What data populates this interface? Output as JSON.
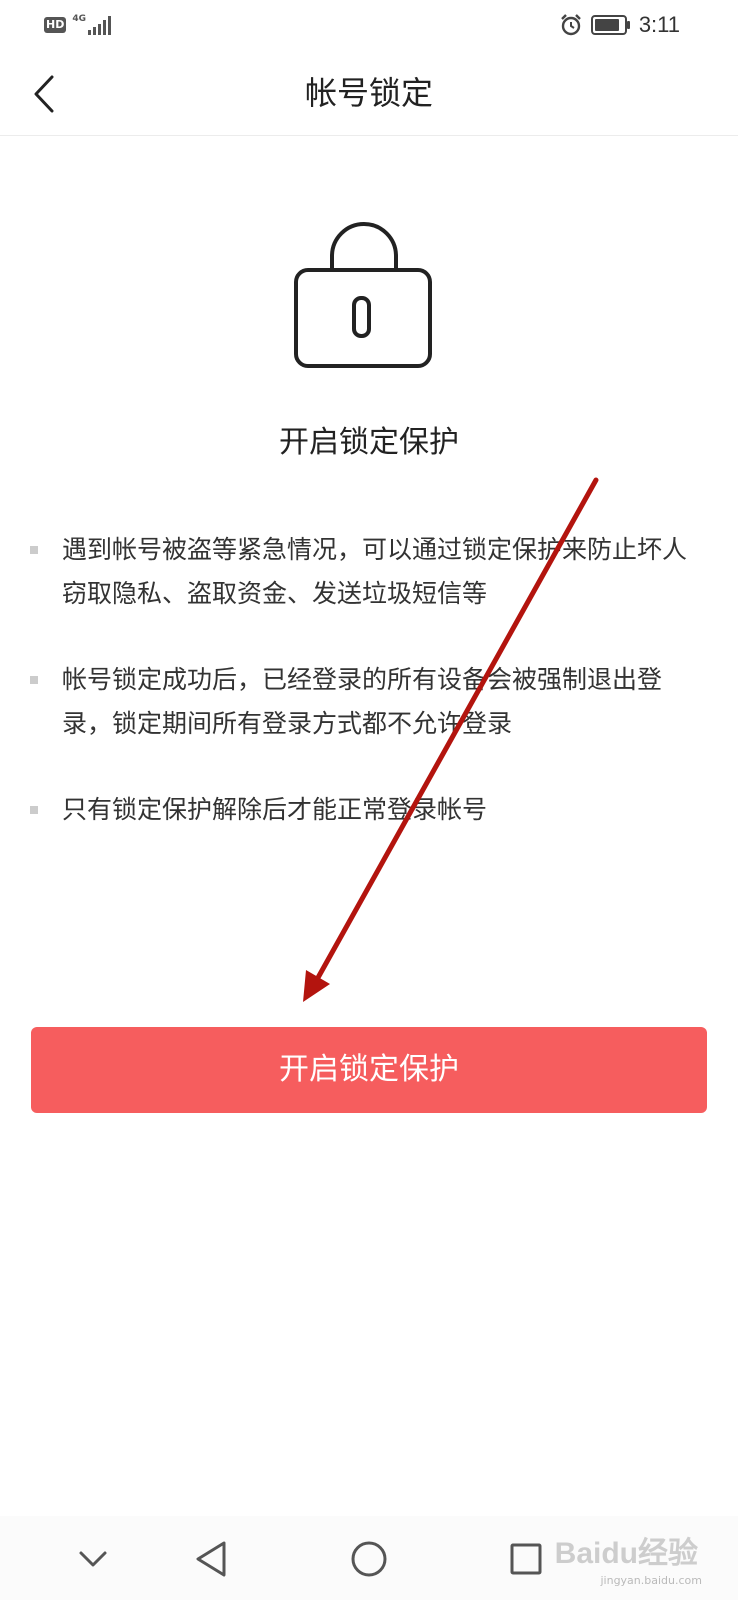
{
  "status_bar": {
    "hd_label": "HD",
    "network_label": "4G",
    "time": "3:11",
    "icons": [
      "hd-badge",
      "signal-icon",
      "alarm-icon",
      "battery-icon"
    ]
  },
  "nav": {
    "title": "帐号锁定",
    "back_icon": "chevron-left-icon"
  },
  "content": {
    "lock_icon": "lock-icon",
    "headline": "开启锁定保护",
    "bullets": [
      "遇到帐号被盗等紧急情况，可以通过锁定保护来防止坏人窃取隐私、盗取资金、发送垃圾短信等",
      "帐号锁定成功后，已经登录的所有设备会被强制退出登录，锁定期间所有登录方式都不允许登录",
      "只有锁定保护解除后才能正常登录帐号"
    ]
  },
  "button": {
    "label": "开启锁定保护",
    "color": "#f65d5e"
  },
  "annotation": {
    "type": "arrow",
    "color": "#b3140e"
  },
  "system_nav": {
    "icons": [
      "collapse-chevron-icon",
      "back-triangle-icon",
      "home-circle-icon",
      "recents-square-icon"
    ]
  },
  "watermark": {
    "text": "Baidu经验",
    "sub": "jingyan.baidu.com"
  }
}
